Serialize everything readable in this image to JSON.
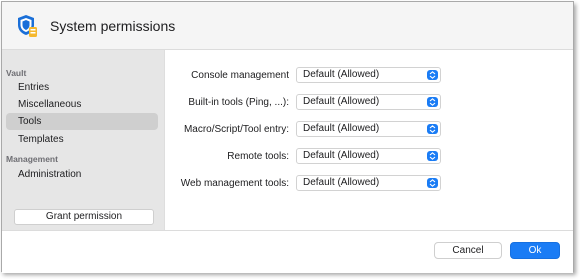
{
  "window": {
    "title": "System permissions"
  },
  "sidebar": {
    "sections": [
      {
        "label": "Vault",
        "items": [
          {
            "label": "Entries"
          },
          {
            "label": "Miscellaneous"
          },
          {
            "label": "Tools",
            "selected": true
          },
          {
            "label": "Templates"
          }
        ]
      },
      {
        "label": "Management",
        "items": [
          {
            "label": "Administration"
          }
        ]
      }
    ],
    "grant_button_label": "Grant permission"
  },
  "permissions": [
    {
      "label": "Console management",
      "value": "Default (Allowed)"
    },
    {
      "label": "Built-in tools (Ping, ...):",
      "value": "Default (Allowed)"
    },
    {
      "label": "Macro/Script/Tool entry:",
      "value": "Default (Allowed)"
    },
    {
      "label": "Remote tools:",
      "value": "Default (Allowed)"
    },
    {
      "label": "Web management tools:",
      "value": "Default (Allowed)"
    }
  ],
  "footer": {
    "cancel_label": "Cancel",
    "ok_label": "Ok"
  },
  "colors": {
    "accent": "#1a7cf5",
    "sidebar_bg": "#e6e6e6",
    "selected_bg": "#cfcfcf",
    "shield": "#1a6fd8",
    "badge": "#f5b82e"
  },
  "icons": {
    "header": "shield-with-vault-icon",
    "select": "chevron-updown-icon"
  }
}
